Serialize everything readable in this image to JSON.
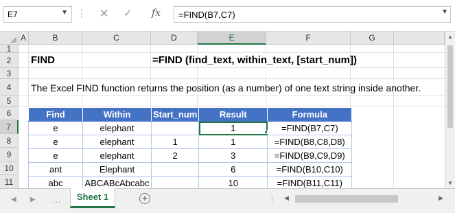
{
  "formula_bar": {
    "name_box": "E7",
    "formula": "=FIND(B7,C7)",
    "fx_label": "fx"
  },
  "columns": [
    "A",
    "B",
    "C",
    "D",
    "E",
    "F",
    "G"
  ],
  "active_column": "E",
  "rows": [
    "1",
    "2",
    "3",
    "4",
    "5",
    "6",
    "7",
    "8",
    "9",
    "10",
    "11"
  ],
  "active_row": "7",
  "sheet": {
    "title": "FIND",
    "syntax": "=FIND (find_text, within_text, [start_num])",
    "description": "The Excel FIND function returns the position (as a number) of one text string inside another."
  },
  "table": {
    "headers": [
      "Find",
      "Within",
      "Start_num",
      "Result",
      "Formula"
    ],
    "rows": [
      [
        "e",
        "elephant",
        "",
        "1",
        "=FIND(B7,C7)"
      ],
      [
        "e",
        "elephant",
        "1",
        "1",
        "=FIND(B8,C8,D8)"
      ],
      [
        "e",
        "elephant",
        "2",
        "3",
        "=FIND(B9,C9,D9)"
      ],
      [
        "ant",
        "Elephant",
        "",
        "6",
        "=FIND(B10,C10)"
      ],
      [
        "abc",
        "ABCABcAbcabc",
        "",
        "10",
        "=FIND(B11,C11)"
      ]
    ]
  },
  "tabs": {
    "active_sheet": "Sheet 1",
    "add_label": "+"
  },
  "colors": {
    "header_fill": "#4472c4",
    "accent": "#217346"
  },
  "icons": [
    "chevron-down-icon",
    "cancel-icon",
    "enter-icon",
    "function-icon",
    "add-sheet-icon"
  ]
}
